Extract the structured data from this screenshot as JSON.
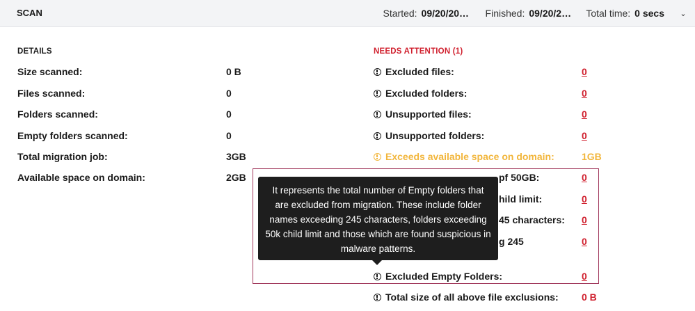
{
  "header": {
    "title": "SCAN",
    "started_label": "Started:",
    "started_value": "09/20/20…",
    "finished_label": "Finished:",
    "finished_value": "09/20/2…",
    "total_time_label": "Total time:",
    "total_time_value": "0 secs"
  },
  "details": {
    "title": "DETAILS",
    "rows": [
      {
        "label": "Size scanned:",
        "value": "0 B"
      },
      {
        "label": "Files scanned:",
        "value": "0"
      },
      {
        "label": "Folders scanned:",
        "value": "0"
      },
      {
        "label": "Empty folders scanned:",
        "value": "0"
      },
      {
        "label": "Total migration job:",
        "value": "3GB"
      },
      {
        "label": "Available space on domain:",
        "value": "2GB"
      }
    ]
  },
  "attention": {
    "title": "NEEDS ATTENTION (1)",
    "rows": [
      {
        "label": "Excluded files:",
        "value": "0"
      },
      {
        "label": "Excluded folders:",
        "value": "0"
      },
      {
        "label": "Unsupported files:",
        "value": "0"
      },
      {
        "label": "Unsupported folders:",
        "value": "0"
      },
      {
        "label": "Exceeds available space on domain:",
        "value": "1GB"
      },
      {
        "label": "pf 50GB:",
        "value": "0"
      },
      {
        "label": "hild limit:",
        "value": "0"
      },
      {
        "label": "45 characters:",
        "value": "0"
      },
      {
        "label": "g 245",
        "value": "0"
      },
      {
        "label": "Excluded Empty Folders:",
        "value": "0"
      },
      {
        "label": "Total size of all above file exclusions:",
        "value": "0 B"
      }
    ]
  },
  "tooltip": {
    "text": "It represents the total number of Empty folders that are excluded from migration. These include folder names exceeding 245 characters, folders exceeding 50k child limit and those which are found suspicious in malware patterns."
  },
  "colors": {
    "error": "#d0202e",
    "warning": "#f2b63c",
    "highlight_border": "#a0365a",
    "tooltip_bg": "#1e1e1e"
  }
}
